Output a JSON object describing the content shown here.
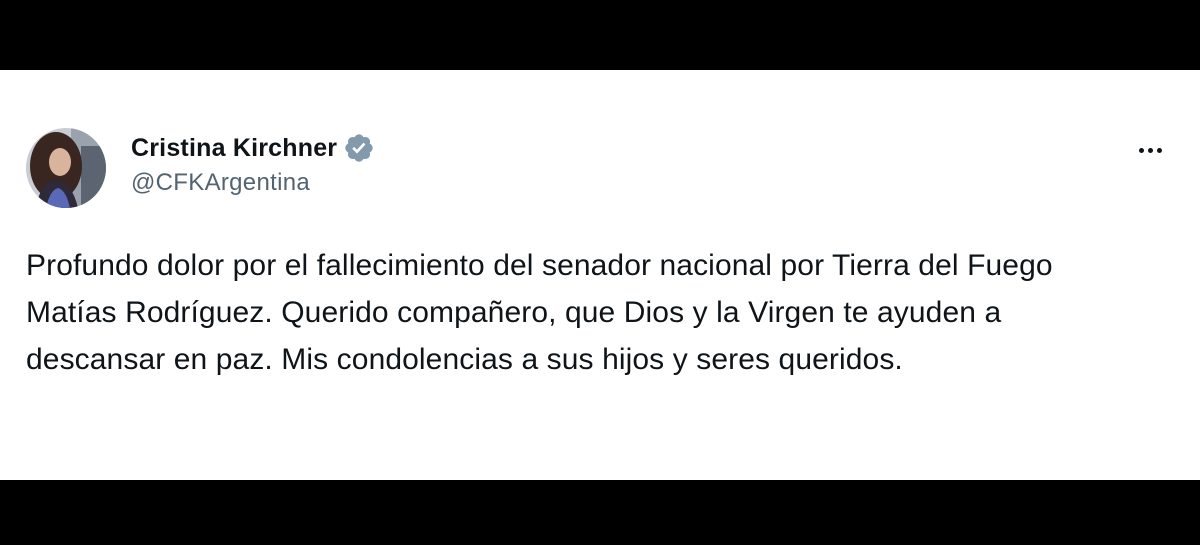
{
  "tweet": {
    "author": {
      "display_name": "Cristina Kirchner",
      "handle": "@CFKArgentina",
      "verified": true
    },
    "text": "Profundo dolor por el fallecimiento del senador nacional por Tierra del Fuego Matías Rodríguez. Querido compañero, que Dios y la Virgen te ayuden a descansar en paz. Mis condolencias a sus hijos y seres queridos."
  },
  "icons": {
    "verified": "verified-badge-icon",
    "more": "more-options-icon"
  },
  "colors": {
    "background_bars": "#000000",
    "card": "#ffffff",
    "text_primary": "#0f1419",
    "text_secondary": "#536471",
    "verified_badge": "#829aab"
  }
}
